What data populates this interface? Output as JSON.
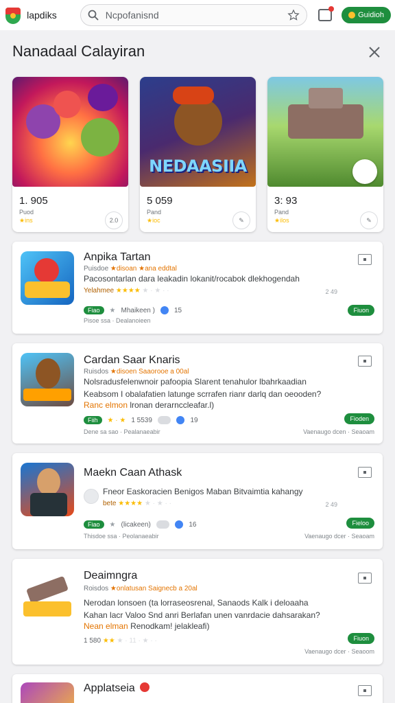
{
  "header": {
    "app_name": "lapdiks",
    "search_placeholder": "Ncpofanisnd",
    "get_label": "Guidioh"
  },
  "section": {
    "title": "Nanadaal Calayiran"
  },
  "featured": [
    {
      "number": "1. 905",
      "category": "Puod",
      "rating": "★ins",
      "badge": "2.0",
      "art_title": ""
    },
    {
      "number": "5 059",
      "category": "Pand",
      "rating": "★ioc",
      "badge": "",
      "art_title": "NEDAASIIA"
    },
    {
      "number": "3: 93",
      "category": "Pand",
      "rating": "★ilos",
      "badge": "",
      "art_title": ""
    }
  ],
  "list": [
    {
      "title": "Anpika Tartan",
      "sub_lead": "Puisdoe",
      "sub_hl": "★disoan ★ana eddtal",
      "desc": "Pacosontarlan dara leakadin lokanit/rocabok dlekhogendah",
      "rating_label": "Yelahmee",
      "rating_stars": "★★★★",
      "rating_dim": "★ · ★ · ·",
      "right_num": "2 49",
      "pill": "Fiao",
      "meta_text": "Mhaikeen )",
      "count": "15",
      "foot": "Pisoe ssa · Dealanoieen",
      "foot_right": "",
      "install": "Fiuon"
    },
    {
      "title": "Cardan Saar Knaris",
      "sub_lead": "Ruisdos",
      "sub_hl": "★disoen Saaorooe a 00al",
      "desc": "Nolsradusfelenwnoir pafoopia Slarent tenahulor lbahrkaadian",
      "desc2": "Keabsom I obalafatien latunge scrrafen rianr darlq dan oeooden?",
      "desc3_hl": "Ranc elmon",
      "desc3": "lronan derarnccleafar.l)",
      "rating_label": "",
      "rating_stars": "★ · ★",
      "rating_dim": "",
      "right_num": "",
      "pill": "Fiih",
      "meta_text": "1 5539",
      "count": "19",
      "foot": "Dene sa sao · Pealanaeabir",
      "foot_right": "Vaenaugo dcen · Seaoam",
      "install": "Fioden"
    },
    {
      "title": "Maekn Caan Athask",
      "sub_lead": "",
      "sub_hl": "",
      "desc": "Fneor Easkoracien Benigos Maban Bitvaimtia kahangy",
      "rating_label": "bete",
      "rating_stars": "★★★★",
      "rating_dim": "★ · ★ · ·",
      "right_num": "2 49",
      "pill": "Fiao",
      "meta_text": "(licakeen)",
      "count": "16",
      "foot": "Thisdoe ssa · Peolanaeabir",
      "foot_right": "Vaenaugo dcer · Seaoam",
      "install": "Fieloo"
    },
    {
      "title": "Deaimngra",
      "sub_lead": "Roisdos",
      "sub_hl": "★onlatusan Saignecb a 20al",
      "desc": "Nerodan lonsoen (ta lorraseosrenal, Sanaods Kalk i deloaaha",
      "desc2": "Kahan lacr Valoo Snd anri Berlafan unen vanrdacie dahsarakan?",
      "desc3_hl": "Nean elman",
      "desc3": "Renodkam! jelakleafi)",
      "rating_label": "1 580",
      "rating_stars": "★★",
      "rating_dim": "★ · 11 · ★ · ·",
      "right_num": "",
      "pill": "",
      "meta_text": "",
      "count": "",
      "foot": "",
      "foot_right": "Vaenaugo dcer · Seaoom",
      "install": "Fiuon"
    },
    {
      "title": "Applatseia",
      "sub_lead": "",
      "sub_hl": "",
      "desc": "",
      "install": ""
    }
  ]
}
